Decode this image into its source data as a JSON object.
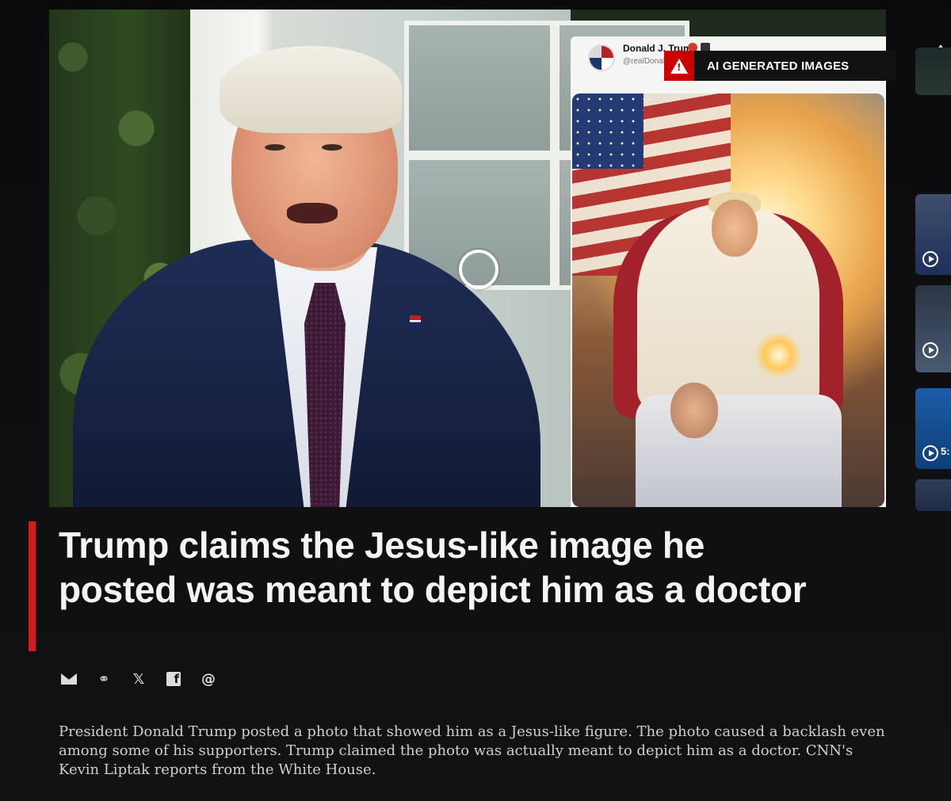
{
  "post": {
    "author_name": "Donald J. Trump",
    "author_handle": "@realDonaldTrump"
  },
  "ai_badge": {
    "label": "AI GENERATED IMAGES"
  },
  "related": {
    "duration_partial": "5:"
  },
  "article": {
    "headline": "Trump claims the Jesus-like image he posted was meant to depict him as a doctor",
    "description": "President Donald Trump posted a photo that showed him as a Jesus-like figure. The photo caused a backlash even among some of his supporters. Trump claimed the photo was actually meant to depict him as a doctor. CNN's Kevin Liptak reports from the White House."
  },
  "share": {
    "x_glyph": "𝕏",
    "facebook_glyph": "f",
    "threads_glyph": "@",
    "link_glyph": "⚭"
  },
  "colors": {
    "accent": "#cc1f1f",
    "badge_warning": "#cc0000",
    "background": "#050506"
  },
  "icons": [
    "email-icon",
    "link-icon",
    "x-icon",
    "facebook-icon",
    "threads-icon",
    "warning-icon",
    "play-icon",
    "chevron-up-icon"
  ]
}
